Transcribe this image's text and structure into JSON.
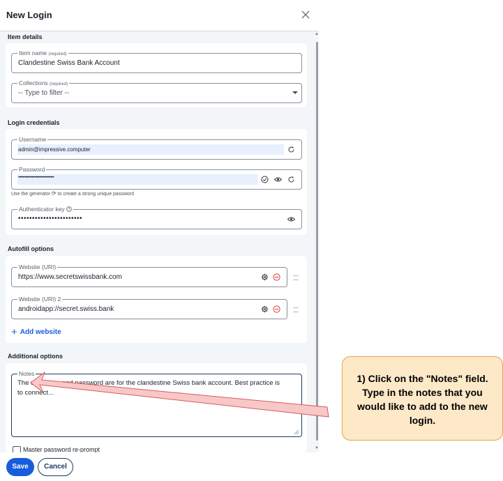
{
  "dialog": {
    "title": "New Login"
  },
  "sections": {
    "item_details": "Item details",
    "login_credentials": "Login credentials",
    "autofill_options": "Autofill options",
    "additional_options": "Additional options"
  },
  "item_name": {
    "label": "Item name",
    "required": "(required)",
    "value": "Clandestine Swiss Bank Account"
  },
  "collections": {
    "label": "Collections",
    "required": "(required)",
    "value": "-- Type to filter --"
  },
  "username": {
    "label": "Username",
    "value": "admin@impressive.computer"
  },
  "password": {
    "label": "Password",
    "value": "••••••••••••••••••••••••••••••••",
    "hint_before": "Use the generator",
    "hint_after": "to create a strong unique password"
  },
  "authenticator": {
    "label": "Authenticator key",
    "value": "•••••••••••••••••••••••"
  },
  "websites": [
    {
      "label": "Website (URI)",
      "value": "https://www.secretswissbank.com"
    },
    {
      "label": "Website (URI) 2",
      "value": "androidapp://secret.swiss.bank"
    }
  ],
  "add_website": "Add website",
  "notes": {
    "label": "Notes",
    "value": "The username and password are for the clandestine Swiss bank account.  Best practice is to connect..."
  },
  "reprompt_label": "Master password re-prompt",
  "footer": {
    "save": "Save",
    "cancel": "Cancel"
  },
  "callout": {
    "text": "1) Click on the \"Notes\" field.  Type in the notes that you would like to add to the new login."
  },
  "colors": {
    "primary": "#175ddc",
    "callout_bg": "#fde9c8",
    "callout_border": "#e2a64a",
    "arrow_fill": "#f8c8c8",
    "arrow_stroke": "#d65b5b"
  },
  "icons": [
    "close-icon",
    "chevron-down-icon",
    "refresh-icon",
    "check-circle-icon",
    "eye-icon",
    "help-icon",
    "gear-icon",
    "remove-icon",
    "drag-handle-icon",
    "plus-icon",
    "resize-icon"
  ]
}
